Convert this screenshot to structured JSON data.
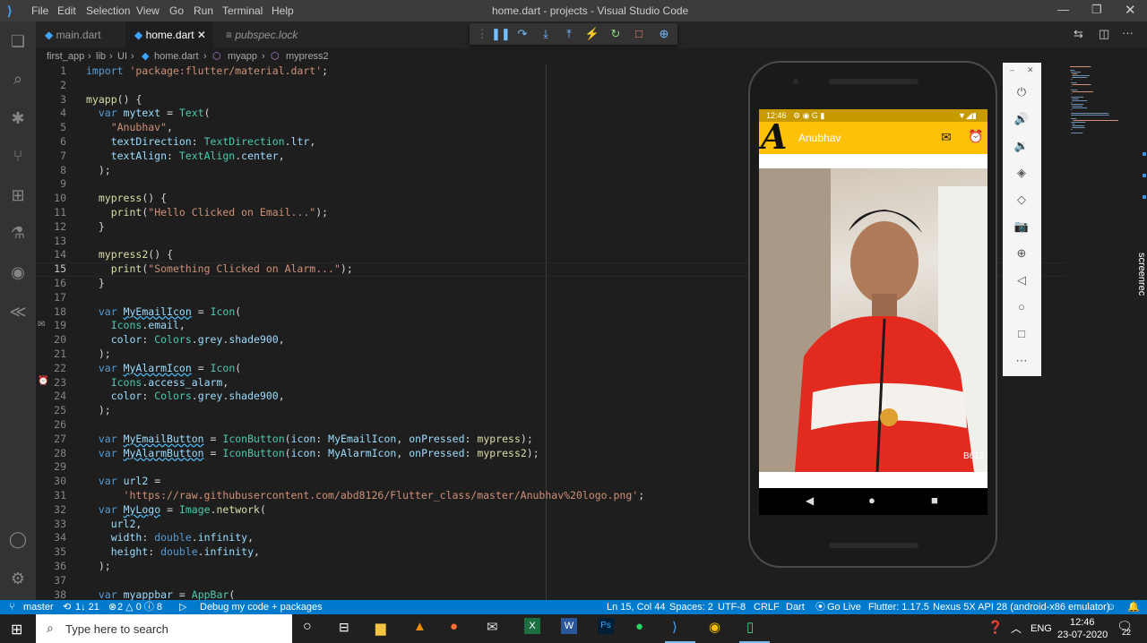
{
  "window": {
    "title": "home.dart - projects - Visual Studio Code",
    "menu": [
      "File",
      "Edit",
      "Selection",
      "View",
      "Go",
      "Run",
      "Terminal",
      "Help"
    ]
  },
  "tabs": [
    {
      "label": "main.dart",
      "active": false
    },
    {
      "label": "home.dart",
      "active": true
    },
    {
      "label": "pubspec.lock",
      "active": false
    }
  ],
  "breadcrumb": [
    "first_app",
    "lib",
    "UI",
    "home.dart",
    "myapp",
    "mypress2"
  ],
  "code_lines": [
    {
      "n": "1",
      "t": "import 'package:flutter/material.dart';"
    },
    {
      "n": "2",
      "t": ""
    },
    {
      "n": "3",
      "t": "myapp() {"
    },
    {
      "n": "4",
      "t": "  var mytext = Text("
    },
    {
      "n": "5",
      "t": "    \"Anubhav\","
    },
    {
      "n": "6",
      "t": "    textDirection: TextDirection.ltr,"
    },
    {
      "n": "7",
      "t": "    textAlign: TextAlign.center,"
    },
    {
      "n": "8",
      "t": "  );"
    },
    {
      "n": "9",
      "t": ""
    },
    {
      "n": "10",
      "t": "  mypress() {"
    },
    {
      "n": "11",
      "t": "    print(\"Hello Clicked on Email...\");"
    },
    {
      "n": "12",
      "t": "  }"
    },
    {
      "n": "13",
      "t": ""
    },
    {
      "n": "14",
      "t": "  mypress2() {"
    },
    {
      "n": "15",
      "t": "    print(\"Something Clicked on Alarm...\");"
    },
    {
      "n": "16",
      "t": "  }"
    },
    {
      "n": "17",
      "t": ""
    },
    {
      "n": "18",
      "t": "  var MyEmailIcon = Icon("
    },
    {
      "n": "19",
      "t": "    Icons.email,"
    },
    {
      "n": "20",
      "t": "    color: Colors.grey.shade900,"
    },
    {
      "n": "21",
      "t": "  );"
    },
    {
      "n": "22",
      "t": "  var MyAlarmIcon = Icon("
    },
    {
      "n": "23",
      "t": "    Icons.access_alarm,"
    },
    {
      "n": "24",
      "t": "    color: Colors.grey.shade900,"
    },
    {
      "n": "25",
      "t": "  );"
    },
    {
      "n": "26",
      "t": ""
    },
    {
      "n": "27",
      "t": "  var MyEmailButton = IconButton(icon: MyEmailIcon, onPressed: mypress);"
    },
    {
      "n": "28",
      "t": "  var MyAlarmButton = IconButton(icon: MyAlarmIcon, onPressed: mypress2);"
    },
    {
      "n": "29",
      "t": ""
    },
    {
      "n": "30",
      "t": "  var url2 ="
    },
    {
      "n": "31",
      "t": "      'https://raw.githubusercontent.com/abd8126/Flutter_class/master/Anubhav%20logo.png';"
    },
    {
      "n": "32",
      "t": "  var MyLogo = Image.network("
    },
    {
      "n": "33",
      "t": "    url2,"
    },
    {
      "n": "34",
      "t": "    width: double.infinity,"
    },
    {
      "n": "35",
      "t": "    height: double.infinity,"
    },
    {
      "n": "36",
      "t": "  );"
    },
    {
      "n": "37",
      "t": ""
    },
    {
      "n": "38",
      "t": "  var myappbar = AppBar("
    }
  ],
  "statusbar": {
    "branch": "master",
    "sync": "1↓ 21",
    "problems": "2 △ 0 ⓘ 8",
    "debug": "Debug my code + packages",
    "position": "Ln 15, Col 44",
    "spaces": "Spaces: 2",
    "encoding": "UTF-8",
    "eol": "CRLF",
    "language": "Dart",
    "golive": "Go Live",
    "flutter": "Flutter: 1.17.5",
    "device": "Nexus 5X API 28 (android-x86 emulator)"
  },
  "phone": {
    "time": "12:46",
    "appbar_title": "Anubhav",
    "logo_letter": "A",
    "watermark": "B612",
    "accent": "#ffc107"
  },
  "taskbar": {
    "search_placeholder": "Type here to search",
    "lang": "ENG",
    "time": "12:46",
    "date": "23-07-2020",
    "notifications": "22"
  },
  "side_label": "screenrec",
  "colors": {
    "statusbar": "#007acc",
    "editor_bg": "#1e1e1e"
  }
}
